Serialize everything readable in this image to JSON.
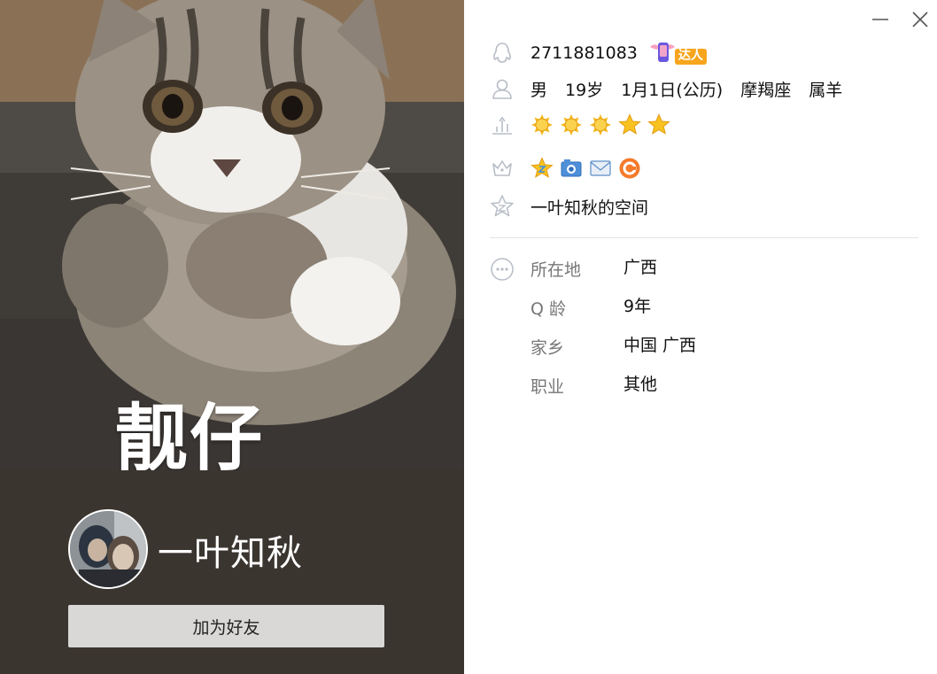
{
  "window": {
    "minimize_icon": "minimize-icon",
    "close_icon": "close-icon"
  },
  "cover": {
    "caption": "靓仔",
    "image": "cat-photo"
  },
  "profile": {
    "nickname": "一叶知秋",
    "add_friend_label": "加为好友",
    "qq_number": "2711881083",
    "expert_badge_text": "达人",
    "gender": "男",
    "age": "19岁",
    "birthday": "1月1日(公历)",
    "constellation": "摩羯座",
    "zodiac": "属羊",
    "level": {
      "suns": 3,
      "stars": 2
    },
    "space_name": "一叶知秋的空间"
  },
  "details": [
    {
      "label": "所在地",
      "value": "广西"
    },
    {
      "label": "Q 龄",
      "value": "9年"
    },
    {
      "label": "家乡",
      "value": "中国 广西"
    },
    {
      "label": "职业",
      "value": "其他"
    }
  ],
  "colors": {
    "footer_bg": "#3b3530",
    "button_bg": "#d9d8d7",
    "icon_gray": "#b7bdc6",
    "sun": "#f5b81c",
    "star": "#f8c322",
    "divider": "#e3e3e3"
  }
}
